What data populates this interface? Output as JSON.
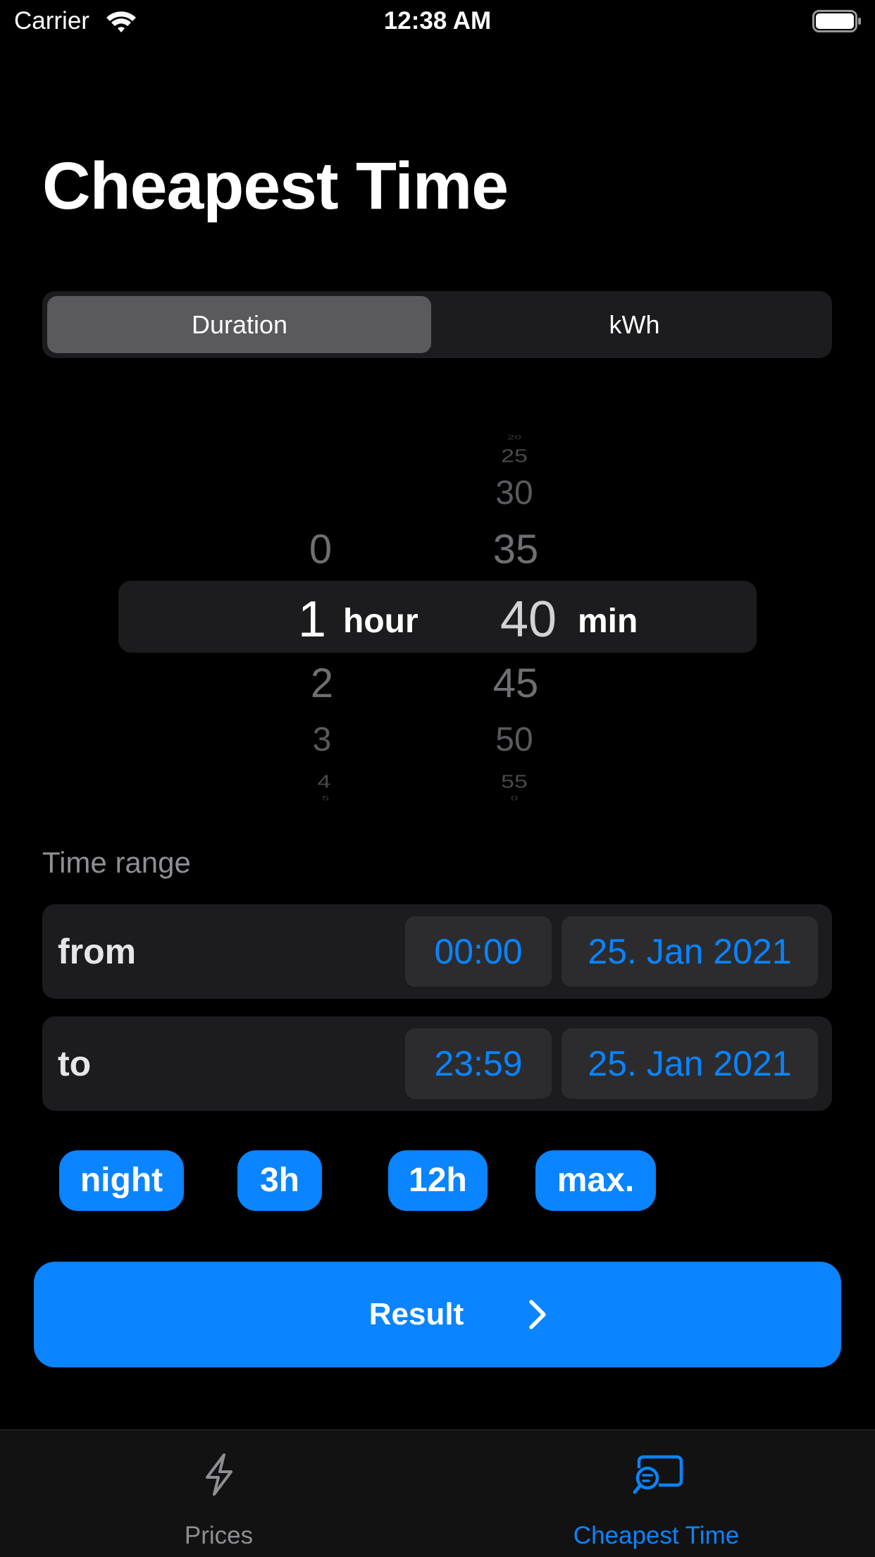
{
  "status_bar": {
    "carrier": "Carrier",
    "time": "12:38 AM"
  },
  "page": {
    "title": "Cheapest Time"
  },
  "segmented_control": {
    "items": [
      "Duration",
      "kWh"
    ],
    "selected": "Duration"
  },
  "duration_picker": {
    "hours": {
      "above": [
        "0"
      ],
      "selected": "1",
      "below": [
        "2",
        "3",
        "4",
        "5"
      ],
      "unit": "hour"
    },
    "minutes": {
      "above": [
        "20",
        "25",
        "30",
        "35"
      ],
      "selected": "40",
      "below": [
        "45",
        "50",
        "55",
        "0"
      ],
      "unit": "min"
    }
  },
  "time_range": {
    "label": "Time range",
    "from": {
      "label": "from",
      "time": "00:00",
      "date": "25. Jan 2021"
    },
    "to": {
      "label": "to",
      "time": "23:59",
      "date": "25. Jan 2021"
    }
  },
  "quick_buttons": [
    "night",
    "3h",
    "12h",
    "max."
  ],
  "result_button": {
    "label": "Result"
  },
  "tab_bar": {
    "tabs": [
      {
        "label": "Prices",
        "icon": "bolt-icon",
        "active": false
      },
      {
        "label": "Cheapest Time",
        "icon": "chat-search-icon",
        "active": true
      }
    ],
    "active_color": "#0a84ff",
    "inactive_color": "#8e8e93"
  },
  "colors": {
    "accent": "#0a84ff",
    "background": "#000000",
    "surface": "#1c1c1e"
  }
}
